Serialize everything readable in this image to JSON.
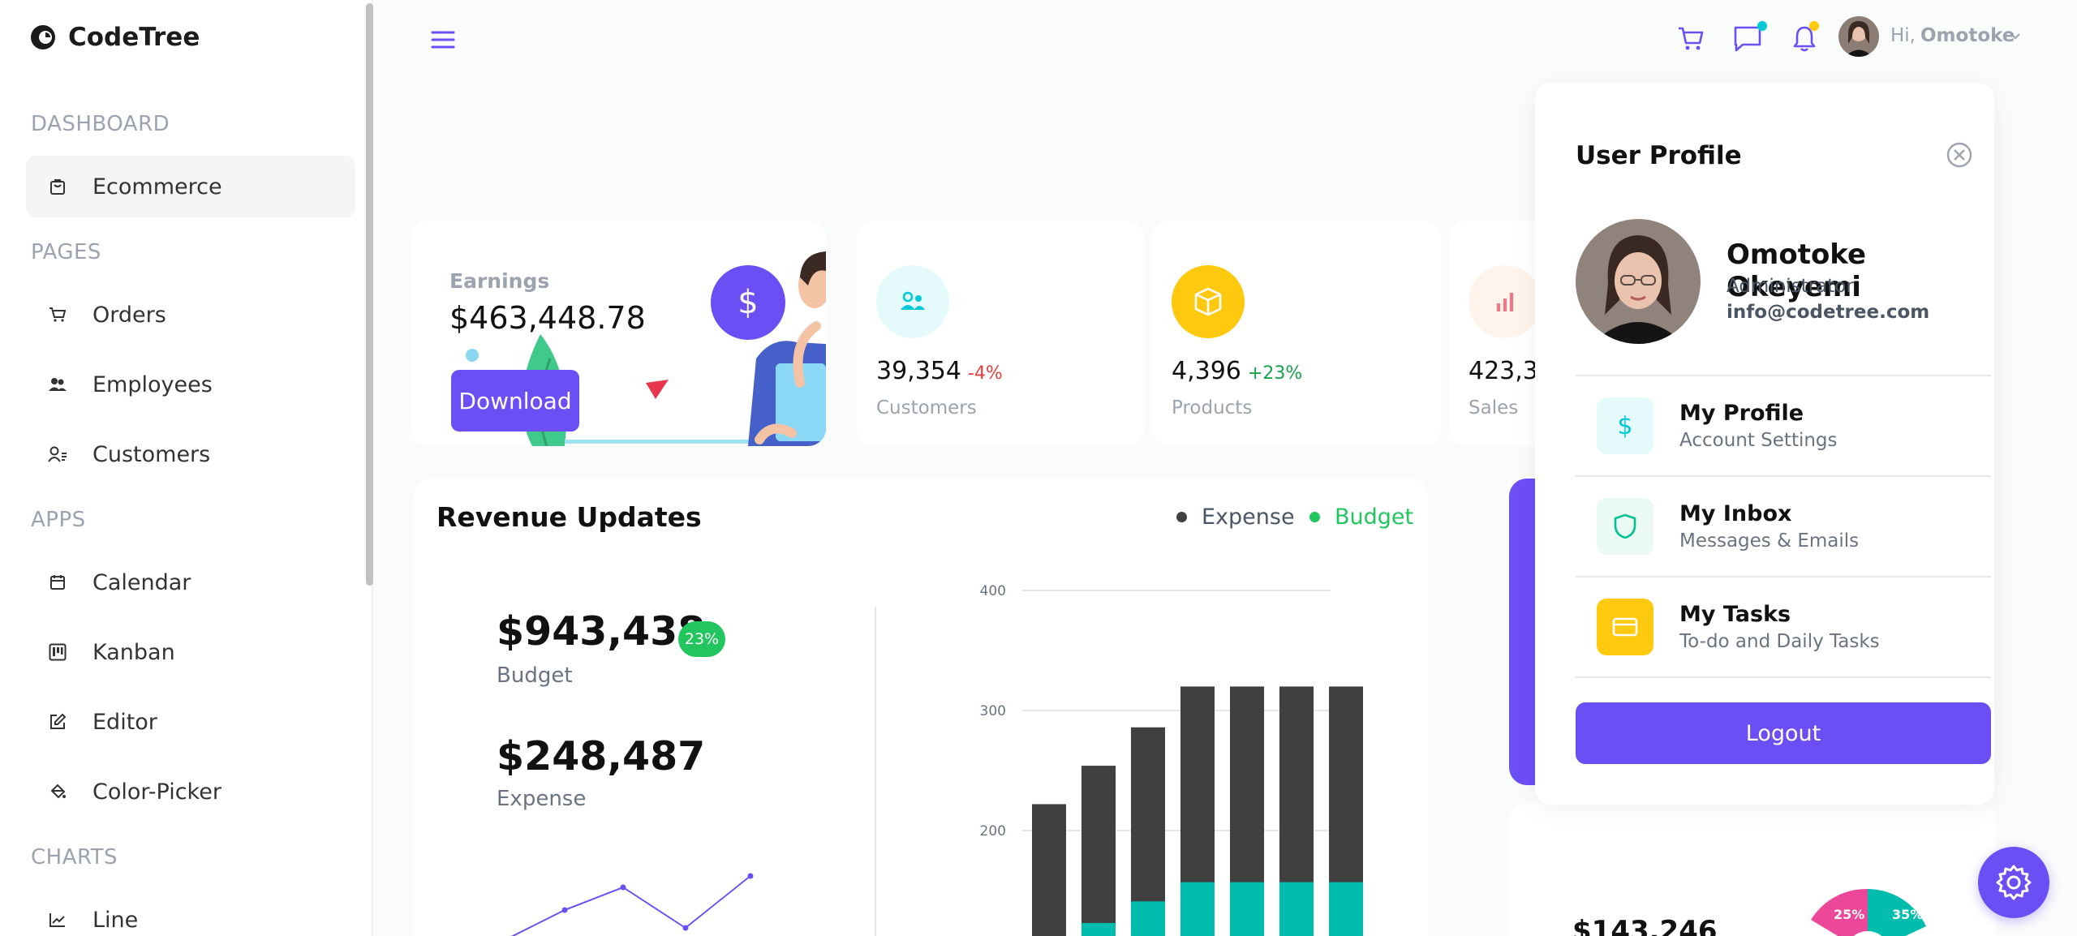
{
  "app": {
    "name": "CodeTree"
  },
  "sidebar": {
    "sections": {
      "dashboard": "DASHBOARD",
      "pages": "PAGES",
      "apps": "APPS",
      "charts": "CHARTS"
    },
    "items": [
      {
        "label": "Ecommerce",
        "icon": "shopping-bag-icon"
      },
      {
        "label": "Orders",
        "icon": "cart-icon"
      },
      {
        "label": "Employees",
        "icon": "people-icon"
      },
      {
        "label": "Customers",
        "icon": "contact-icon"
      },
      {
        "label": "Calendar",
        "icon": "calendar-icon"
      },
      {
        "label": "Kanban",
        "icon": "kanban-icon"
      },
      {
        "label": "Editor",
        "icon": "edit-icon"
      },
      {
        "label": "Color-Picker",
        "icon": "paint-bucket-icon"
      },
      {
        "label": "Line",
        "icon": "line-chart-icon"
      }
    ]
  },
  "topbar": {
    "greeting": "Hi,",
    "username": "Omotoke"
  },
  "earnings": {
    "label": "Earnings",
    "value": "$463,448.78",
    "button": "Download",
    "badge_symbol": "$"
  },
  "stats": [
    {
      "value": "39,354",
      "change": "-4%",
      "label": "Customers",
      "icon": "people-icon",
      "change_color": "#e53e3e"
    },
    {
      "value": "4,396",
      "change": "+23%",
      "label": "Products",
      "icon": "box-icon",
      "change_color": "#16a34a"
    },
    {
      "value": "423,39",
      "change": "",
      "label": "Sales",
      "icon": "bar-chart-icon",
      "change_color": "#16a34a"
    }
  ],
  "revenue": {
    "title": "Revenue Updates",
    "legend_expense": "Expense",
    "legend_budget": "Budget",
    "budget_value": "$943,438",
    "budget_pct": "23%",
    "budget_label": "Budget",
    "expense_value": "$248,487",
    "expense_label": "Expense"
  },
  "chart_data": {
    "type": "bar",
    "stacked": true,
    "yticks": [
      200,
      300,
      400
    ],
    "ylim_visible": [
      120,
      400
    ],
    "series": [
      {
        "name": "Expense",
        "color": "#404041",
        "values": [
          222,
          254,
          286,
          320,
          320,
          320,
          320
        ]
      },
      {
        "name": "Budget",
        "color": "#00bdae",
        "values": [
          100,
          123,
          141,
          157,
          157,
          157,
          157
        ]
      }
    ]
  },
  "colors": {
    "accent": "#6c4ef5",
    "teal": "#03c9d7",
    "yellow": "#fec90f",
    "green": "#22c55e"
  },
  "profile": {
    "title": "User Profile",
    "name": "Omotoke Okeyemi",
    "role": "Administrator",
    "email": "info@codetree.com",
    "items": [
      {
        "title": "My Profile",
        "subtitle": "Account Settings",
        "icon": "dollar-icon"
      },
      {
        "title": "My Inbox",
        "subtitle": "Messages & Emails",
        "icon": "shield-icon"
      },
      {
        "title": "My Tasks",
        "subtitle": "To-do and Daily Tasks",
        "icon": "card-icon"
      }
    ],
    "logout": "Logout"
  },
  "partial": {
    "amount": "$143,246",
    "pie_left": "25%",
    "pie_right": "35%"
  }
}
